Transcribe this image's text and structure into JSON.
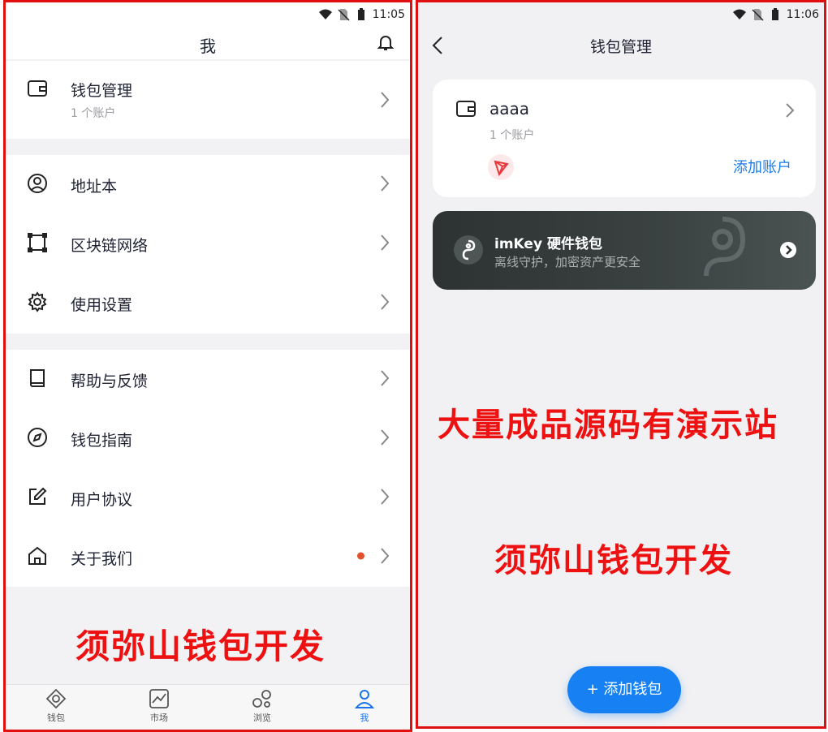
{
  "left": {
    "status": {
      "time": "11:05"
    },
    "title": "我",
    "wallet_row": {
      "label": "钱包管理",
      "sub": "1 个账户"
    },
    "group2": [
      {
        "label": "地址本",
        "icon": "user-circle-icon"
      },
      {
        "label": "区块链网络",
        "icon": "network-icon"
      },
      {
        "label": "使用设置",
        "icon": "gear-icon"
      }
    ],
    "group3": [
      {
        "label": "帮助与反馈",
        "icon": "book-icon"
      },
      {
        "label": "钱包指南",
        "icon": "compass-icon"
      },
      {
        "label": "用户协议",
        "icon": "edit-icon"
      },
      {
        "label": "关于我们",
        "icon": "home-icon"
      }
    ],
    "watermark": "须弥山钱包开发",
    "tabs": [
      {
        "label": "钱包"
      },
      {
        "label": "市场"
      },
      {
        "label": "浏览"
      },
      {
        "label": "我"
      }
    ],
    "colors": {
      "accent": "#1a73e8",
      "dot": "#e2502d"
    }
  },
  "right": {
    "status": {
      "time": "11:06"
    },
    "title": "钱包管理",
    "wallet": {
      "name": "aaaa",
      "sub": "1 个账户",
      "add_account": "添加账户"
    },
    "imkey": {
      "title": "imKey 硬件钱包",
      "sub": "离线守护，加密资产更安全"
    },
    "watermark1": "大量成品源码有演示站",
    "watermark2": "须弥山钱包开发",
    "add_wallet": "+ 添加钱包",
    "colors": {
      "accent": "#1781f3",
      "tron": "#e8383d"
    }
  }
}
